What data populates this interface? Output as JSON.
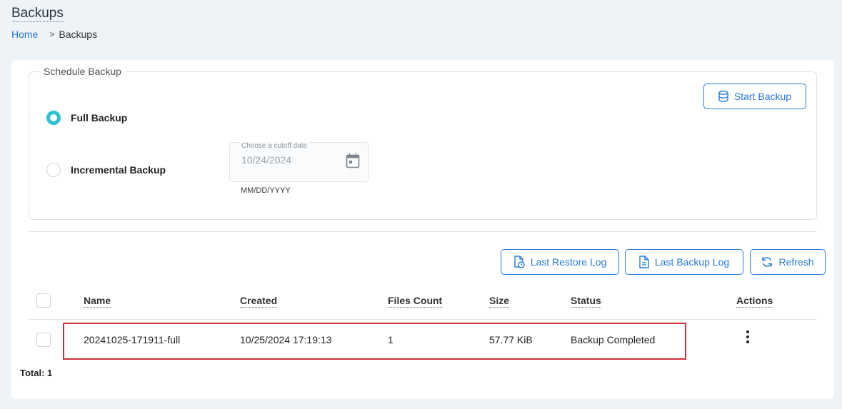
{
  "header": {
    "title": "Backups",
    "breadcrumb": {
      "home": "Home",
      "separator": ">",
      "current": "Backups"
    }
  },
  "schedule": {
    "legend": "Schedule Backup",
    "options": [
      {
        "label": "Full Backup",
        "selected": true
      },
      {
        "label": "Incremental Backup",
        "selected": false
      }
    ],
    "date_field": {
      "label": "Choose a cutoff date",
      "value": "10/24/2024",
      "hint": "MM/DD/YYYY",
      "icon": "calendar-icon"
    },
    "start_button": {
      "label": "Start Backup",
      "icon": "database-icon"
    }
  },
  "toolbar": {
    "last_restore_log": {
      "label": "Last Restore Log",
      "icon": "file-clock-icon"
    },
    "last_backup_log": {
      "label": "Last Backup Log",
      "icon": "file-text-icon"
    },
    "refresh": {
      "label": "Refresh",
      "icon": "refresh-icon"
    }
  },
  "table": {
    "columns": [
      "Name",
      "Created",
      "Files Count",
      "Size",
      "Status",
      "Actions"
    ],
    "rows": [
      {
        "name": "20241025-171911-full",
        "created": "10/25/2024 17:19:13",
        "files_count": "1",
        "size": "57.77 KiB",
        "status": "Backup Completed"
      }
    ],
    "total": "Total: 1"
  },
  "colors": {
    "accent": "#2a7bd6",
    "radio": "#2cc2d0",
    "highlight": "#d32f3a",
    "background": "#eef3f7"
  }
}
